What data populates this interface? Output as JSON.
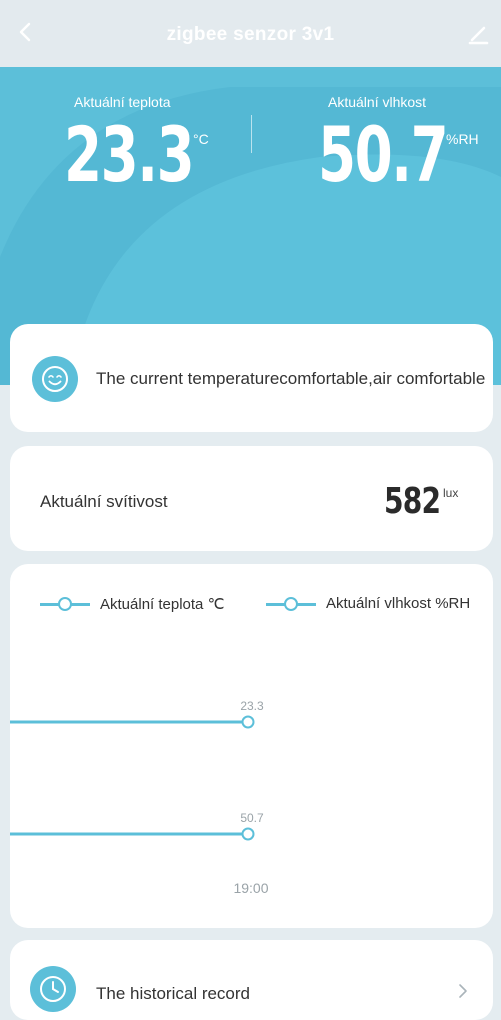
{
  "header": {
    "title": "zigbee senzor 3v1",
    "back_icon": "chevron-left-icon",
    "edit_icon": "pencil-icon"
  },
  "hero": {
    "temperature": {
      "label": "Aktuální teplota",
      "value": "23.3",
      "unit": "°C"
    },
    "humidity": {
      "label": "Aktuální vlhkost",
      "value": "50.7",
      "unit": "%RH"
    },
    "background_color": "#5cbfd9"
  },
  "comfort": {
    "icon": "smiley-face-icon",
    "text": "The current temperaturecomfortable,air comfortable"
  },
  "illuminance": {
    "label": "Aktuální svítivost",
    "value": "582",
    "unit": "lux"
  },
  "chart_data": {
    "type": "line",
    "series": [
      {
        "name": "Aktuální teplota ℃",
        "values": [
          23.3
        ],
        "value_label": "23.3"
      },
      {
        "name": "Aktuální vlhkost %RH",
        "values": [
          50.7
        ],
        "value_label": "50.7"
      }
    ],
    "categories": [
      "19:00"
    ],
    "x_tick_label": "19:00",
    "legend_position": "top",
    "line_color": "#5cbfd9"
  },
  "history": {
    "icon": "clock-icon",
    "label": "The historical record",
    "chevron": "chevron-right-icon"
  },
  "colors": {
    "accent": "#5cbfd9",
    "page_bg": "#e4ecf0"
  }
}
